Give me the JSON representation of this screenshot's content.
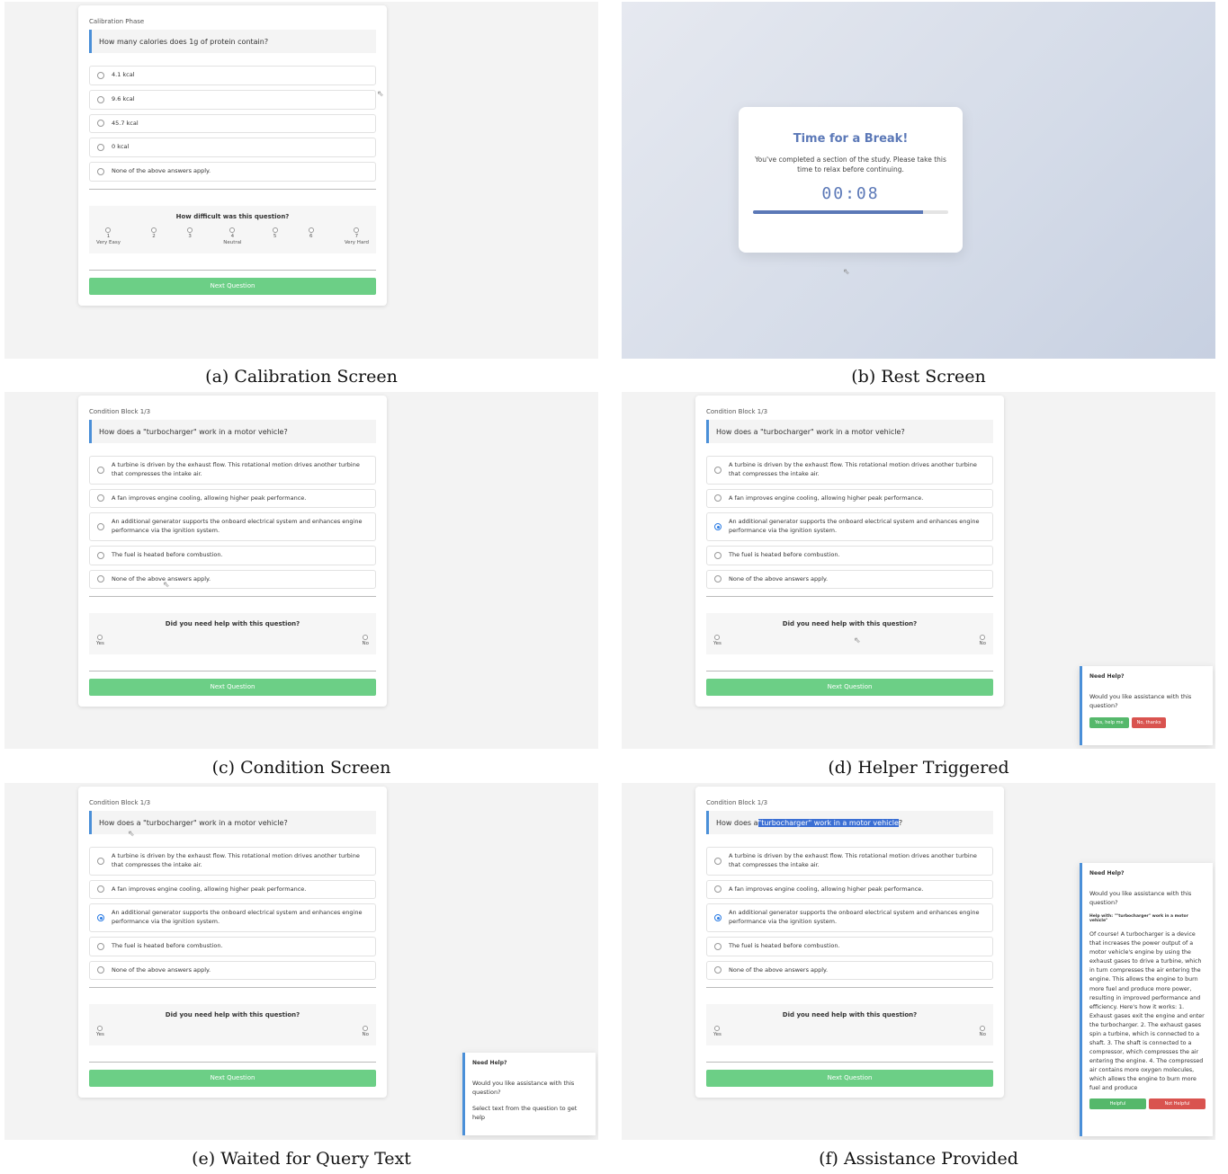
{
  "calibration": {
    "block_label": "Calibration Phase",
    "question": "How many calories does 1g of protein contain?",
    "options": [
      "4.1 kcal",
      "9.6 kcal",
      "45.7 kcal",
      "0 kcal",
      "None of the above answers apply."
    ],
    "difficulty_title": "How difficult was this question?",
    "scale": [
      {
        "num": "1",
        "label": "Very Easy"
      },
      {
        "num": "2",
        "label": ""
      },
      {
        "num": "3",
        "label": ""
      },
      {
        "num": "4",
        "label": "Neutral"
      },
      {
        "num": "5",
        "label": ""
      },
      {
        "num": "6",
        "label": ""
      },
      {
        "num": "7",
        "label": "Very Hard"
      }
    ],
    "next_label": "Next Question",
    "caption": "(a) Calibration Screen"
  },
  "rest": {
    "title": "Time for a Break!",
    "text": "You've completed a section of the study. Please take this time to relax before continuing.",
    "timer": "00:08",
    "progress": 0.87,
    "caption": "(b) Rest Screen"
  },
  "condition": {
    "block_label": "Condition Block 1/3",
    "question": "How does a \"turbocharger\" work in a motor vehicle?",
    "q_prefix": "How does a ",
    "q_highlight": "\"turbocharger\" work in a motor vehicle",
    "q_suffix": "?",
    "options": [
      "A turbine is driven by the exhaust flow. This rotational motion drives another turbine that compresses the intake air.",
      "A fan improves engine cooling, allowing higher peak performance.",
      "An additional generator supports the onboard electrical system and enhances engine performance via the ignition system.",
      "The fuel is heated before combustion.",
      "None of the above answers apply."
    ],
    "help_title": "Did you need help with this question?",
    "yes": "Yes",
    "no": "No",
    "next_label": "Next Question"
  },
  "captions": {
    "c": "(c) Condition Screen",
    "d": "(d) Helper Triggered",
    "e": "(e) Waited for Query Text",
    "f": "(f) Assistance Provided"
  },
  "helper": {
    "title": "Need Help?",
    "prompt": "Would you like assistance with this question?",
    "yes_btn": "Yes, help me",
    "no_btn": "No, thanks",
    "select_hint": "Select text from the question to get help",
    "help_with": "Help with: \"\"turbocharger\" work in a motor vehicle\"",
    "answer": "Of course! A turbocharger is a device that increases the power output of a motor vehicle's engine by using the exhaust gases to drive a turbine, which in turn compresses the air entering the engine. This allows the engine to burn more fuel and produce more power, resulting in improved performance and efficiency. Here's how it works: 1. Exhaust gases exit the engine and enter the turbocharger. 2. The exhaust gases spin a turbine, which is connected to a shaft. 3. The shaft is connected to a compressor, which compresses the air entering the engine. 4. The compressed air contains more oxygen molecules, which allows the engine to burn more fuel and produce",
    "helpful": "Helpful",
    "not_helpful": "Not Helpful"
  },
  "colors": {
    "accent": "#4a8fd8",
    "next_green": "#6ccf86",
    "break_blue": "#5b78b7"
  }
}
